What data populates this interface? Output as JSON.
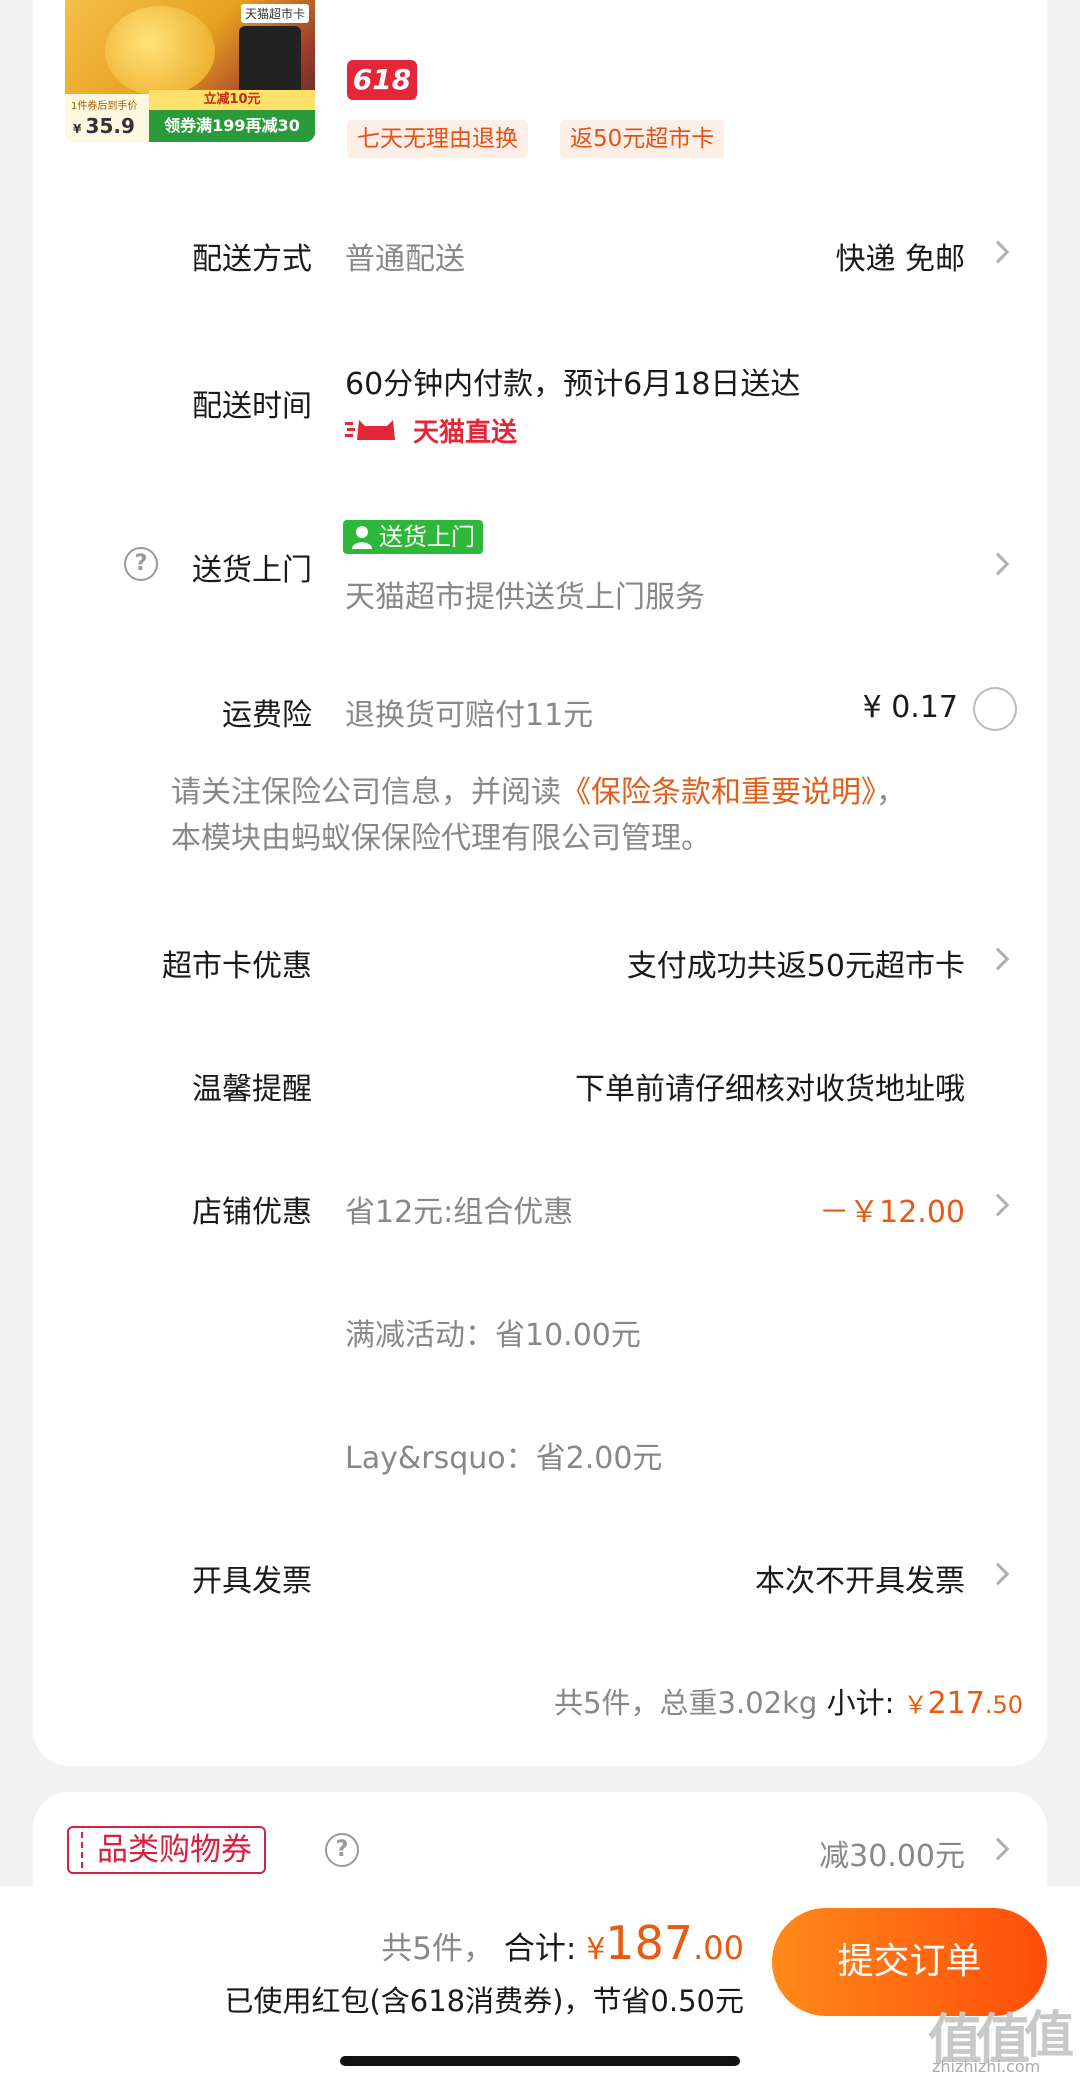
{
  "product": {
    "thumb_tag": "天猫超市卡",
    "thumb_small_note": "1件券后到手价",
    "thumb_price": "35.9",
    "thumb_cut": "立减10元",
    "thumb_coupon": "领券满199再减30",
    "badge": "618",
    "tags": [
      "七天无理由退换",
      "返50元超市卡"
    ]
  },
  "delivery_method": {
    "label": "配送方式",
    "value": "普通配送",
    "right": "快递 免邮"
  },
  "delivery_time": {
    "label": "配送时间",
    "value": "60分钟内付款，预计6月18日送达",
    "brand": "天猫直送"
  },
  "door_delivery": {
    "label": "送货上门",
    "badge": "送货上门",
    "desc": "天猫超市提供送货上门服务"
  },
  "shipping_insurance": {
    "label": "运费险",
    "value": "退换货可赔付11元",
    "price": "¥ 0.17"
  },
  "notice": {
    "prefix": "请关注保险公司信息，并阅读",
    "link": "《保险条款和重要说明》",
    "suffix": "，",
    "line2": "本模块由蚂蚁保保险代理有限公司管理。"
  },
  "market_card": {
    "label": "超市卡优惠",
    "value": "支付成功共返50元超市卡"
  },
  "reminder": {
    "label": "温馨提醒",
    "value": "下单前请仔细核对收货地址哦"
  },
  "store_discount": {
    "label": "店铺优惠",
    "value": "省12元:组合优惠",
    "amount": "－￥12.00",
    "sub1": "满减活动：省10.00元",
    "sub2": "Lay&rsquo：省2.00元"
  },
  "invoice": {
    "label": "开具发票",
    "value": "本次不开具发票"
  },
  "subtotal": {
    "summary": "共5件，总重3.02kg",
    "label": "小计:",
    "yen": "￥",
    "int": "217",
    "dec": ".50"
  },
  "category_coupon": {
    "label": "品类购物券",
    "value": "减30.00元"
  },
  "bottom": {
    "count": "共5件，",
    "total_label": "合计:",
    "yen": "¥",
    "total_int": "187",
    "total_dec": ".00",
    "saved": "已使用红包(含618消费券)，节省0.50元",
    "submit": "提交订单"
  },
  "watermark": {
    "glyphs": "值值值",
    "url": "zhizhizhi.com"
  },
  "colors": {
    "accent": "#e85a10",
    "tmall_red": "#e4263a",
    "green": "#2db83a",
    "submit_from": "#ff8a1a",
    "submit_to": "#ff4d0a"
  }
}
